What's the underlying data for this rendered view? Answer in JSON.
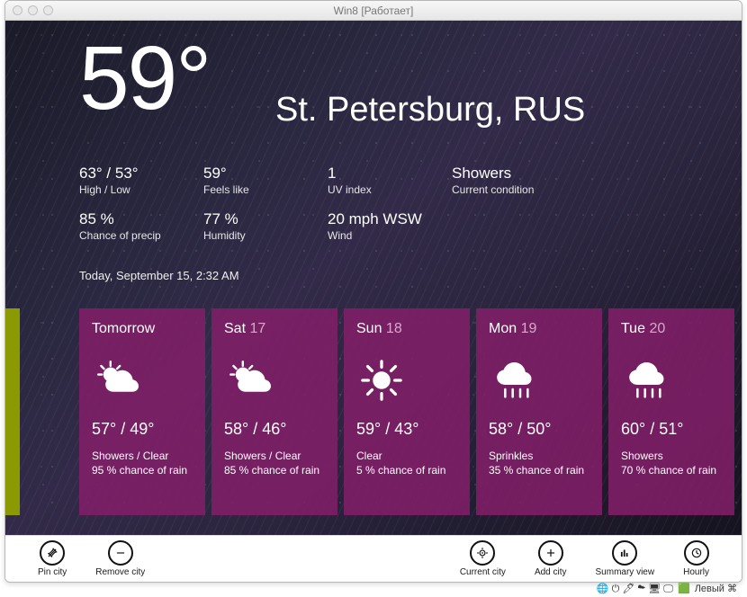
{
  "window": {
    "title": "Win8 [Работает]"
  },
  "location": "St. Petersburg, RUS",
  "current_temp": "59°",
  "stats": {
    "highlow": {
      "value": "63° / 53°",
      "label": "High / Low"
    },
    "feels": {
      "value": "59°",
      "label": "Feels like"
    },
    "uv": {
      "value": "1",
      "label": "UV index"
    },
    "cond": {
      "value": "Showers",
      "label": "Current condition"
    },
    "precip": {
      "value": "85 %",
      "label": "Chance of precip"
    },
    "humid": {
      "value": "77 %",
      "label": "Humidity"
    },
    "wind": {
      "value": "20 mph WSW",
      "label": "Wind"
    }
  },
  "timestamp": "Today, September 15, 2:32 AM",
  "forecast": [
    {
      "day": "Tomorrow",
      "dim": "",
      "icon": "partly-cloudy",
      "temps": "57° / 49°",
      "cond": "Showers / Clear",
      "rain": "95 % chance of rain"
    },
    {
      "day": "Sat",
      "dim": "17",
      "icon": "partly-cloudy",
      "temps": "58° / 46°",
      "cond": "Showers / Clear",
      "rain": "85 % chance of rain"
    },
    {
      "day": "Sun",
      "dim": "18",
      "icon": "sunny",
      "temps": "59° / 43°",
      "cond": "Clear",
      "rain": "5 % chance of rain"
    },
    {
      "day": "Mon",
      "dim": "19",
      "icon": "rain",
      "temps": "58° / 50°",
      "cond": "Sprinkles",
      "rain": "35 % chance of rain"
    },
    {
      "day": "Tue",
      "dim": "20",
      "icon": "rain",
      "temps": "60° / 51°",
      "cond": "Showers",
      "rain": "70 % chance of rain"
    }
  ],
  "appbar": {
    "pin": "Pin city",
    "remove": "Remove city",
    "current": "Current city",
    "add": "Add city",
    "summary": "Summary view",
    "hourly": "Hourly"
  },
  "statusbar_text": "Левый ⌘"
}
